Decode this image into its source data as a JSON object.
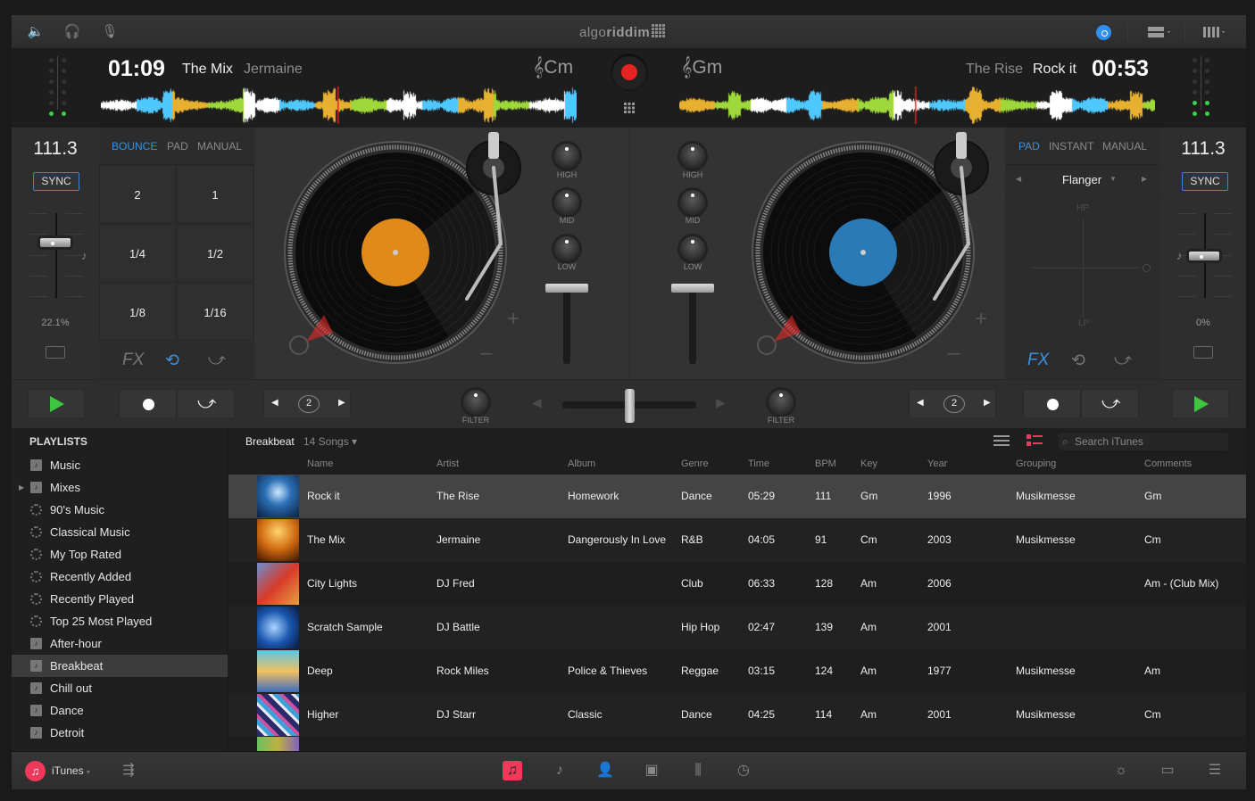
{
  "topbar": {
    "icons": [
      "speaker-icon",
      "headphones-icon",
      "microphone-icon"
    ],
    "logo_light": "algo",
    "logo_bold": "riddim",
    "right_icons": [
      "audio-output-icon",
      "layout-icon",
      "columns-icon"
    ]
  },
  "deck_left": {
    "time": "01:09",
    "title": "The Mix",
    "artist": "Jermaine",
    "key": "Cm",
    "bpm": "111.3",
    "sync_label": "SYNC",
    "pitch_percent": "22.1%",
    "pitch_fraction": 0.35,
    "tabs": [
      "BOUNCE",
      "PAD",
      "MANUAL"
    ],
    "active_tab": "BOUNCE",
    "pads": [
      "2",
      "1",
      "1/4",
      "1/2",
      "1/8",
      "1/16"
    ],
    "fx_label": "FX",
    "loop_count": "2",
    "filter_label": "FILTER",
    "eq": [
      "HIGH",
      "MID",
      "LOW"
    ],
    "volume_fraction": 1.0
  },
  "deck_right": {
    "time": "00:53",
    "title": "Rock it",
    "artist": "The Rise",
    "key": "Gm",
    "bpm": "111.3",
    "sync_label": "SYNC",
    "pitch_percent": "0%",
    "pitch_fraction": 0.5,
    "tabs": [
      "PAD",
      "INSTANT",
      "MANUAL"
    ],
    "active_tab": "PAD",
    "fx_name": "Flanger",
    "fx_pad_top": "HP",
    "fx_pad_bottom": "LP",
    "fx_label": "FX",
    "loop_count": "2",
    "filter_label": "FILTER",
    "eq": [
      "HIGH",
      "MID",
      "LOW"
    ],
    "volume_fraction": 1.0
  },
  "crossfader_fraction": 0.5,
  "colors": {
    "accent": "#3a8fe0",
    "record": "#e52323",
    "play": "#3bc83f",
    "itunes": "#f0395a"
  },
  "library": {
    "playlists_heading": "PLAYLISTS",
    "playlists": [
      {
        "label": "Music",
        "icon": "playlist-icon"
      },
      {
        "label": "Mixes",
        "icon": "folder-icon",
        "expandable": true
      },
      {
        "label": "90's Music",
        "icon": "smart-playlist-icon"
      },
      {
        "label": "Classical Music",
        "icon": "smart-playlist-icon"
      },
      {
        "label": "My Top Rated",
        "icon": "smart-playlist-icon"
      },
      {
        "label": "Recently Added",
        "icon": "smart-playlist-icon"
      },
      {
        "label": "Recently Played",
        "icon": "smart-playlist-icon"
      },
      {
        "label": "Top 25 Most Played",
        "icon": "smart-playlist-icon"
      },
      {
        "label": "After-hour",
        "icon": "playlist-icon"
      },
      {
        "label": "Breakbeat",
        "icon": "playlist-icon",
        "selected": true
      },
      {
        "label": "Chill out",
        "icon": "playlist-icon"
      },
      {
        "label": "Dance",
        "icon": "playlist-icon"
      },
      {
        "label": "Detroit",
        "icon": "playlist-icon"
      }
    ],
    "current_playlist": "Breakbeat",
    "song_count": "14 Songs",
    "search_placeholder": "Search iTunes",
    "columns": [
      "Name",
      "Artist",
      "Album",
      "Genre",
      "Time",
      "BPM",
      "Key",
      "Year",
      "Grouping",
      "Comments"
    ],
    "rows": [
      {
        "name": "Rock it",
        "artist": "The Rise",
        "album": "Homework",
        "genre": "Dance",
        "time": "05:29",
        "bpm": "111",
        "key": "Gm",
        "year": "1996",
        "grouping": "Musikmesse",
        "comments": "Gm",
        "selected": true
      },
      {
        "name": "The Mix",
        "artist": "Jermaine",
        "album": "Dangerously In Love",
        "genre": "R&B",
        "time": "04:05",
        "bpm": "91",
        "key": "Cm",
        "year": "2003",
        "grouping": "Musikmesse",
        "comments": "Cm"
      },
      {
        "name": "City Lights",
        "artist": "DJ Fred",
        "album": "",
        "genre": "Club",
        "time": "06:33",
        "bpm": "128",
        "key": "Am",
        "year": "2006",
        "grouping": "",
        "comments": "Am - (Club Mix)"
      },
      {
        "name": "Scratch Sample",
        "artist": "DJ Battle",
        "album": "",
        "genre": "Hip Hop",
        "time": "02:47",
        "bpm": "139",
        "key": "Am",
        "year": "2001",
        "grouping": "",
        "comments": ""
      },
      {
        "name": "Deep",
        "artist": "Rock Miles",
        "album": "Police & Thieves",
        "genre": "Reggae",
        "time": "03:15",
        "bpm": "124",
        "key": "Am",
        "year": "1977",
        "grouping": "Musikmesse",
        "comments": "Am"
      },
      {
        "name": "Higher",
        "artist": "DJ Starr",
        "album": "Classic",
        "genre": "Dance",
        "time": "04:25",
        "bpm": "114",
        "key": "Am",
        "year": "2001",
        "grouping": "Musikmesse",
        "comments": "Cm"
      }
    ]
  },
  "bottombar": {
    "source_label": "iTunes",
    "center_icons": [
      "playlists-icon",
      "songs-icon",
      "artists-icon",
      "albums-icon",
      "genres-icon",
      "history-icon"
    ],
    "right_icons": [
      "brightness-icon",
      "deck-view-icon",
      "queue-list-icon"
    ]
  }
}
